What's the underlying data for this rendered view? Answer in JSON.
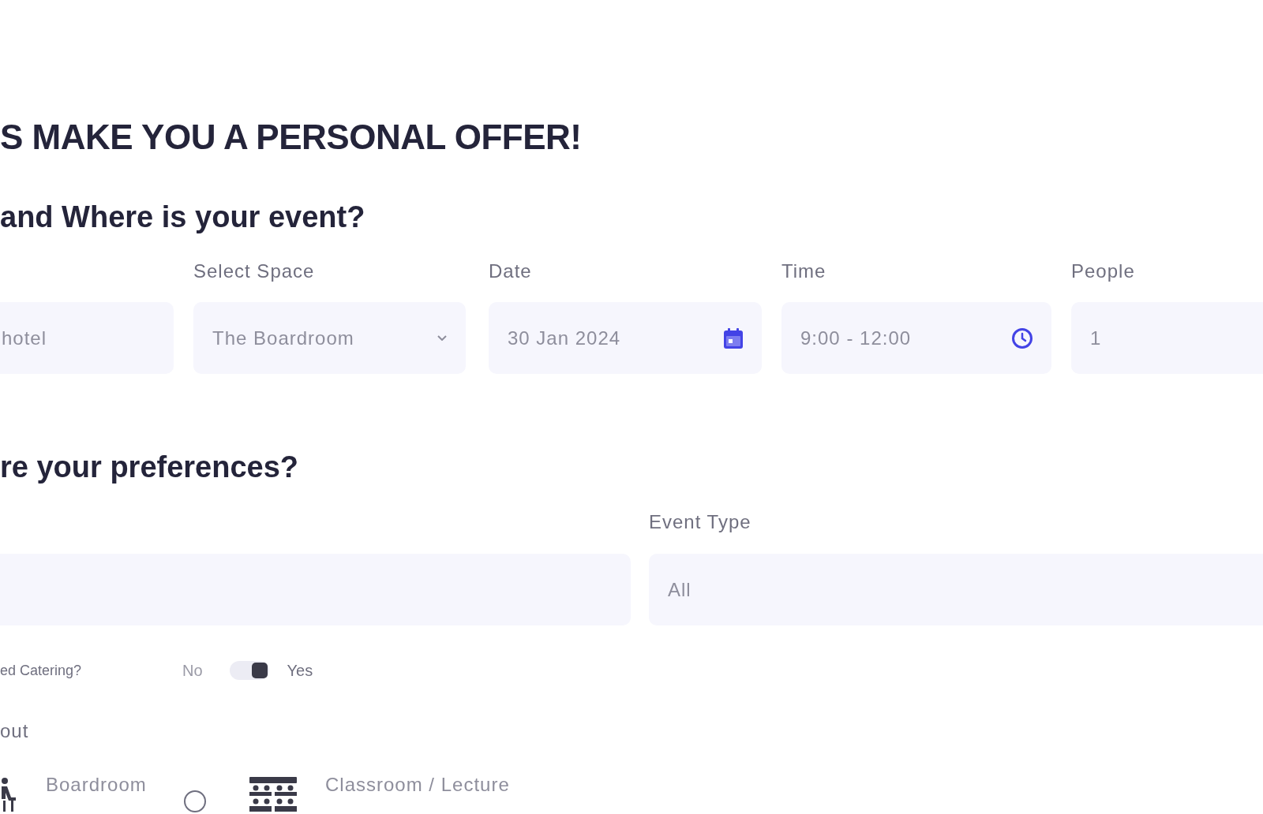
{
  "heading": "S MAKE YOU A PERSONAL OFFER!",
  "where_section": {
    "title": "and Where is your event?",
    "fields": [
      {
        "kind": "text",
        "value": "hotel"
      },
      {
        "kind": "select",
        "label": "Select Space",
        "value": "The Boardroom"
      },
      {
        "kind": "date",
        "label": "Date",
        "value": "30 Jan 2024"
      },
      {
        "kind": "time",
        "label": "Time",
        "value": "9:00 - 12:00"
      },
      {
        "kind": "number",
        "label": "People",
        "value": "1"
      }
    ]
  },
  "preferences_section": {
    "title": "re your preferences?",
    "fields": [
      {
        "kind": "text"
      },
      {
        "kind": "text",
        "label": "Event Type",
        "value": "All"
      }
    ],
    "catering": {
      "label": "ed Catering?",
      "off_label": "No",
      "on_label": "Yes",
      "on": true
    },
    "layout": {
      "label": "out",
      "options": [
        {
          "kind": "boardroom",
          "name": "Boardroom",
          "selected": false
        },
        {
          "kind": "classroom",
          "name": "Classroom / Lecture",
          "selected": false
        }
      ]
    }
  }
}
